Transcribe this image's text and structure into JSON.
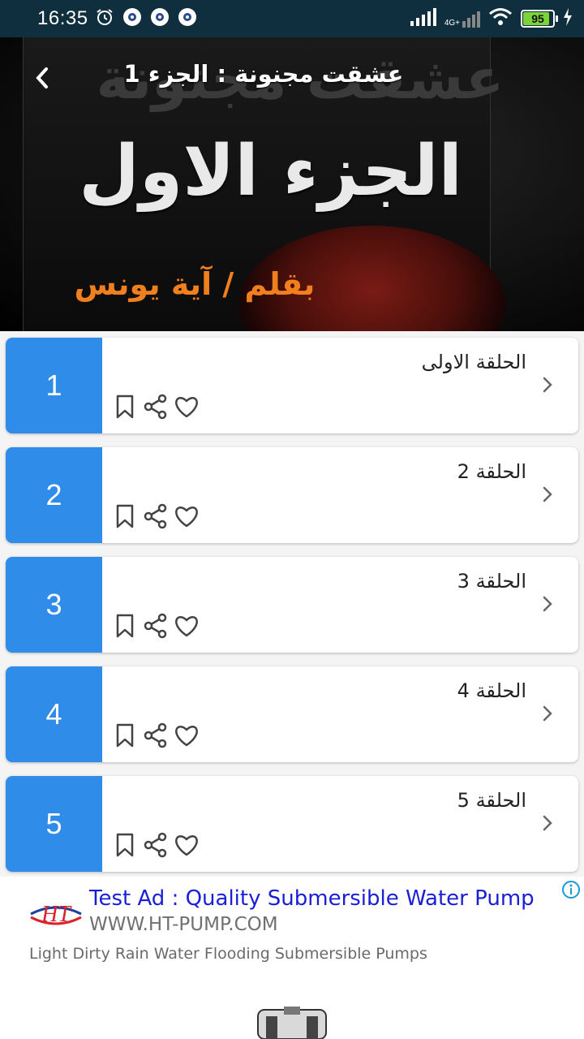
{
  "status_bar": {
    "time": "16:35",
    "network": "4G+",
    "battery": "95",
    "battery_level": 0.95
  },
  "header": {
    "title": "عشقت مجنونة : الجزء 1",
    "cover_title": "عشقت مجنونة",
    "cover_part": "الجزء الاول",
    "cover_author": "بقلم / آية يونس",
    "back_icon": "chevron-left-icon"
  },
  "episodes": [
    {
      "number": "1",
      "title": "الحلقة الاولى"
    },
    {
      "number": "2",
      "title": "الحلقة 2"
    },
    {
      "number": "3",
      "title": "الحلقة 3"
    },
    {
      "number": "4",
      "title": "الحلقة 4"
    },
    {
      "number": "5",
      "title": "الحلقة 5"
    }
  ],
  "episode_actions": [
    "bookmark-icon",
    "share-icon",
    "heart-icon"
  ],
  "ad": {
    "logo_text": "HT",
    "headline": "Test Ad : Quality Submersible Water Pump",
    "url": "WWW.HT-PUMP.COM",
    "description": "Light Dirty Rain Water Flooding Submersible Pumps"
  },
  "colors": {
    "status_bar": "#0f2f3f",
    "episode_badge": "#2f8ce9",
    "ad_headline": "#1a1fd6",
    "author_text": "#f07f1e"
  }
}
